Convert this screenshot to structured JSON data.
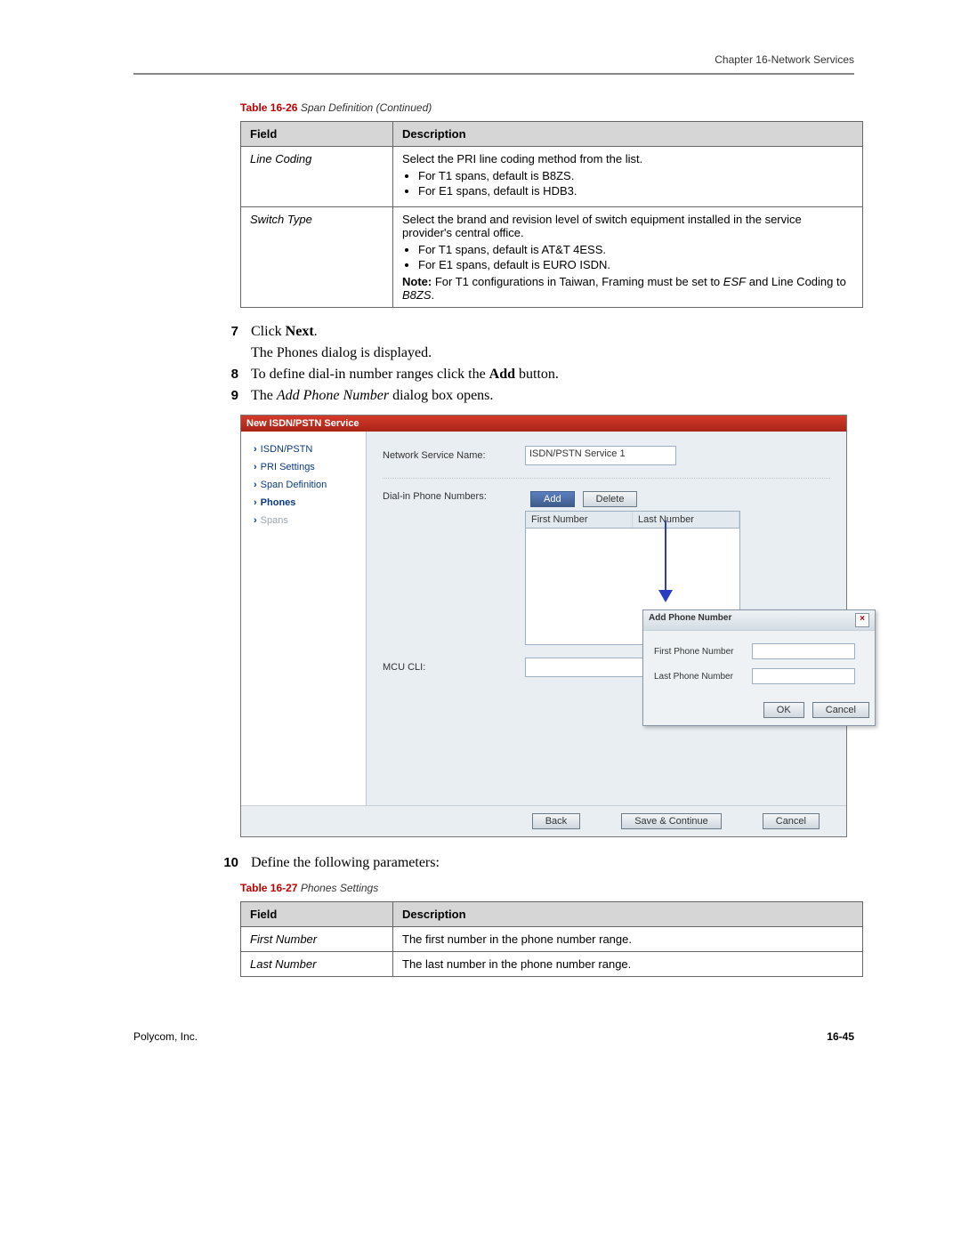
{
  "header": {
    "chapter": "Chapter 16-Network Services"
  },
  "table26": {
    "caption_bold": "Table 16-26",
    "caption_rest": " Span Definition (Continued)",
    "col1": "Field",
    "col2": "Description",
    "rows": [
      {
        "field": "Line Coding",
        "desc_intro": "Select the PRI line coding method from the list.",
        "b1": "For T1 spans, default is B8ZS.",
        "b2": "For E1 spans, default is HDB3."
      },
      {
        "field": "Switch Type",
        "desc_intro": "Select the brand and revision level of switch equipment installed in the service provider's central office.",
        "b1": "For T1 spans, default is AT&T 4ESS.",
        "b2": "For E1 spans, default is EURO ISDN.",
        "note_label": "Note:",
        "note_text": " For T1 configurations in Taiwan, Framing must be set to ",
        "note_esf": "ESF",
        "note_tail": " and Line Coding to ",
        "note_b8zs": "B8ZS",
        "note_end": "."
      }
    ]
  },
  "steps": {
    "s7": {
      "num": "7",
      "pre": "Click ",
      "bold": "Next",
      "post": "."
    },
    "s7b": {
      "pre": "The ",
      "it": "Phones",
      "post": " dialog is displayed."
    },
    "s8": {
      "num": "8",
      "pre": "To define dial-in number ranges click the ",
      "bold": "Add",
      "post": " button."
    },
    "s9": {
      "num": "9",
      "pre": "The ",
      "it": "Add Phone Number",
      "post": " dialog box opens."
    },
    "s10": {
      "num": "10",
      "text": "Define the following parameters:"
    }
  },
  "screenshot": {
    "title": "New ISDN/PSTN Service",
    "sidebar": [
      "ISDN/PSTN",
      "PRI Settings",
      "Span Definition",
      "Phones",
      "Spans"
    ],
    "nsn_label": "Network Service Name:",
    "nsn_value": "ISDN/PSTN Service 1",
    "dialin_label": "Dial-in Phone Numbers:",
    "add_btn": "Add",
    "del_btn": "Delete",
    "th1": "First Number",
    "th2": "Last Number",
    "mcu_label": "MCU CLI:",
    "dialog": {
      "title": "Add Phone Number",
      "f1": "First Phone Number",
      "f2": "Last Phone Number",
      "ok": "OK",
      "cancel": "Cancel"
    },
    "footer": {
      "back": "Back",
      "save": "Save & Continue",
      "cancel": "Cancel"
    }
  },
  "table27": {
    "caption_bold": "Table 16-27",
    "caption_rest": " Phones Settings",
    "col1": "Field",
    "col2": "Description",
    "r1f": "First Number",
    "r1d": "The first number in the phone number range.",
    "r2f": "Last Number",
    "r2d": "The last number in the phone number range."
  },
  "footer": {
    "left": "Polycom, Inc.",
    "right": "16-45"
  }
}
